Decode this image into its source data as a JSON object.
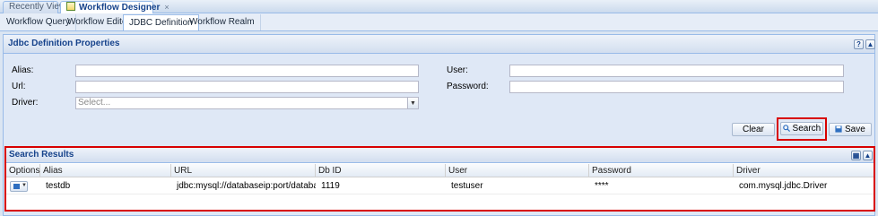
{
  "top_tabs": [
    {
      "label": "Recently View",
      "active": false
    },
    {
      "label": "Workflow Designer",
      "active": true,
      "icon": "workflow-designer-icon",
      "close_glyph": "×"
    }
  ],
  "sub_tabs": [
    {
      "label": "Workflow Query",
      "active": false
    },
    {
      "label": "Workflow Editor",
      "active": false
    },
    {
      "label": "JDBC Definition",
      "active": true
    },
    {
      "label": "Workflow Realm",
      "active": false
    }
  ],
  "form_panel": {
    "title": "Jdbc Definition Properties",
    "fields": {
      "alias": {
        "label": "Alias:",
        "value": ""
      },
      "url": {
        "label": "Url:",
        "value": ""
      },
      "driver": {
        "label": "Driver:",
        "value": "",
        "placeholder": "Select..."
      },
      "user": {
        "label": "User:",
        "value": ""
      },
      "password": {
        "label": "Password:",
        "value": ""
      }
    },
    "buttons": {
      "clear": "Clear",
      "search": "Search",
      "save": "Save"
    }
  },
  "results": {
    "title": "Search Results",
    "columns": [
      "Options",
      "Alias",
      "URL",
      "Db ID",
      "User",
      "Password",
      "Driver"
    ],
    "rows": [
      {
        "alias": "testdb",
        "url": "jdbc:mysql://databaseip:port/databasename",
        "db_id": "1119",
        "user": "testuser",
        "password": "****",
        "driver": "com.mysql.jdbc.Driver"
      }
    ]
  },
  "colors": {
    "accent": "#15428b",
    "highlight": "#d80000",
    "border": "#99bbe8"
  }
}
